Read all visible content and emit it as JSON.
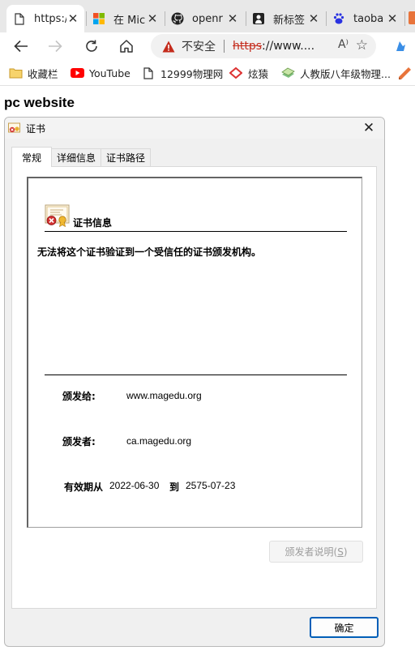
{
  "browser": {
    "tabs": [
      {
        "title": "https:/",
        "icon": "page-icon",
        "active": true
      },
      {
        "title": "在 Mic",
        "icon": "microsoft-icon",
        "active": false
      },
      {
        "title": "openr",
        "icon": "github-icon",
        "active": false
      },
      {
        "title": "新标签",
        "icon": "newtab-icon",
        "active": false
      },
      {
        "title": "taoba",
        "icon": "baidu-icon",
        "active": false
      }
    ],
    "address": {
      "security_label": "不安全",
      "scheme": "https",
      "rest": "://www....",
      "read_aloud": "A⁾"
    },
    "bookmarks": [
      {
        "label": "收藏栏",
        "icon": "folder-icon"
      },
      {
        "label": "YouTube",
        "icon": "youtube-icon"
      },
      {
        "label": "12999物理网",
        "icon": "page-icon"
      },
      {
        "label": "炫猿",
        "icon": "xuanyuan-icon"
      },
      {
        "label": "人教版八年级物理...",
        "icon": "book-icon"
      }
    ]
  },
  "page": {
    "heading": "pc website"
  },
  "dialog": {
    "title": "证书",
    "tabs": [
      "常规",
      "详细信息",
      "证书路径"
    ],
    "cert_info_title": "证书信息",
    "message": "无法将这个证书验证到一个受信任的证书颁发机构。",
    "issued_to_label": "颁发给:",
    "issued_to": "www.magedu.org",
    "issued_by_label": "颁发者:",
    "issued_by": "ca.magedu.org",
    "valid_from_label": "有效期从",
    "valid_from": "2022-06-30",
    "to_label": "到",
    "valid_to": "2575-07-23",
    "issuer_statement_button": "颁发者说明(",
    "issuer_statement_accel": "S",
    "issuer_statement_close": ")",
    "ok_button": "确定"
  },
  "colors": {
    "warning": "#c42b1c",
    "accent": "#005fb8",
    "youtube": "#ff0000"
  }
}
